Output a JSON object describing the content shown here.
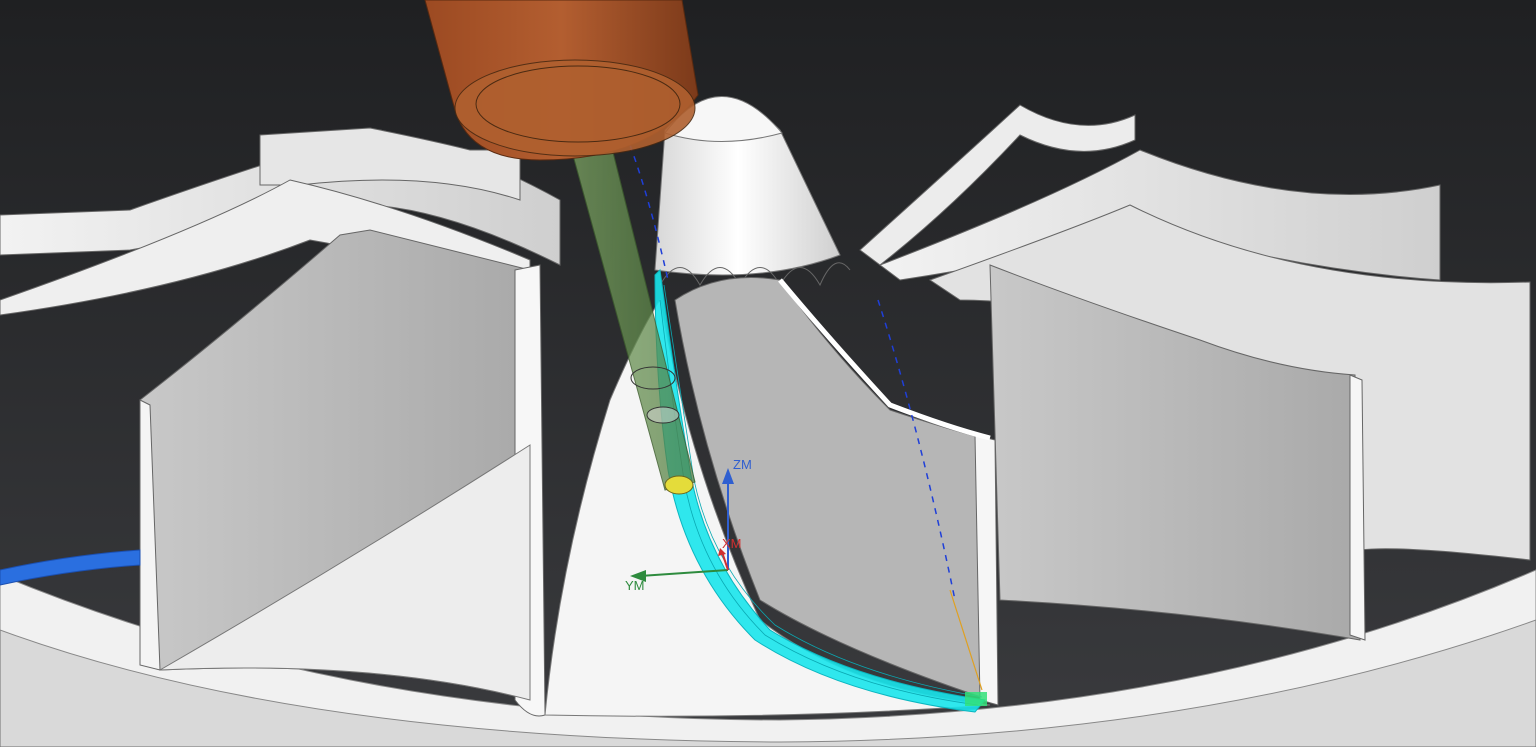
{
  "viewport": {
    "background_top": "#1f2022",
    "background_bottom": "#3a3b3e"
  },
  "axes": {
    "z_label": "ZM",
    "x_label": "XM",
    "y_label": "YM",
    "z_color": "#2f5fd0",
    "x_color": "#d03030",
    "y_color": "#2e8b3e"
  },
  "scene_colors": {
    "part": "#e4e4e4",
    "part_shadow": "#b8b8b8",
    "tool_holder": "#a8532a",
    "tool": "#6a8f52",
    "toolpath": "#19e6ec",
    "retract_path": "#2a6fe0"
  }
}
